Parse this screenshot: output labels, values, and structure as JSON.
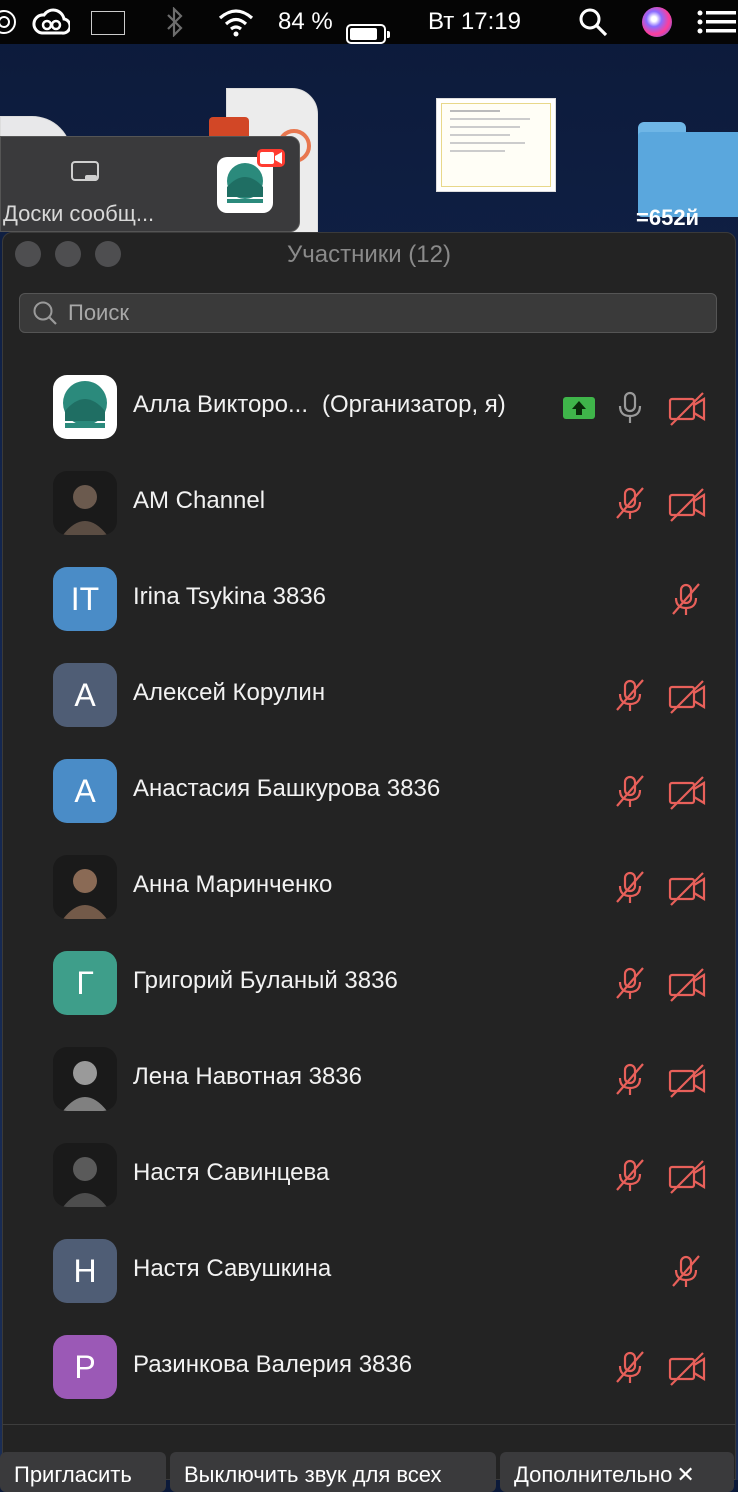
{
  "menubar": {
    "battery_percent": "84 %",
    "battery_level": 0.84,
    "datetime": "Вт 17:19",
    "icons": [
      "app-icon",
      "creative-cloud-icon",
      "flag-ru-icon",
      "bluetooth-icon",
      "wifi-icon",
      "battery-icon",
      "search-icon",
      "siri-icon",
      "menu-list-icon"
    ]
  },
  "desktop": {
    "folder_label": "=652й"
  },
  "mini_window": {
    "label": "Доски сообщ..."
  },
  "panel": {
    "title": "Участники (12)",
    "search_placeholder": "Поиск"
  },
  "participants": [
    {
      "name": "Алла Викторо...",
      "role": "(Организатор, я)",
      "avatar": {
        "type": "logo"
      },
      "sharing": true,
      "mic": "on",
      "cam": "off"
    },
    {
      "name": "AM Channel",
      "role": "",
      "avatar": {
        "type": "photo",
        "color": "#6b5a4e"
      },
      "sharing": false,
      "mic": "muted",
      "cam": "off"
    },
    {
      "name": "Irina Tsykina 3836",
      "role": "",
      "avatar": {
        "type": "initials",
        "text": "IT",
        "color": "#4a8cc7"
      },
      "sharing": false,
      "mic": "muted",
      "cam": "none"
    },
    {
      "name": "Алексей Корулин",
      "role": "",
      "avatar": {
        "type": "initials",
        "text": "А",
        "color": "#4f5d75"
      },
      "sharing": false,
      "mic": "muted",
      "cam": "off"
    },
    {
      "name": "Анастасия Башкурова 3836",
      "role": "",
      "avatar": {
        "type": "initials",
        "text": "А",
        "color": "#4a8cc7"
      },
      "sharing": false,
      "mic": "muted",
      "cam": "off"
    },
    {
      "name": "Анна Маринченко",
      "role": "",
      "avatar": {
        "type": "photo",
        "color": "#8a6a55"
      },
      "sharing": false,
      "mic": "muted",
      "cam": "off"
    },
    {
      "name": "Григорий Буланый 3836",
      "role": "",
      "avatar": {
        "type": "initials",
        "text": "Г",
        "color": "#3e9e8a"
      },
      "sharing": false,
      "mic": "muted",
      "cam": "off"
    },
    {
      "name": "Лена Навотная 3836",
      "role": "",
      "avatar": {
        "type": "photo",
        "color": "#9a9a9a"
      },
      "sharing": false,
      "mic": "muted",
      "cam": "off"
    },
    {
      "name": "Настя Савинцева",
      "role": "",
      "avatar": {
        "type": "photo",
        "color": "#5a5a5a"
      },
      "sharing": false,
      "mic": "muted",
      "cam": "off"
    },
    {
      "name": "Настя Савушкина",
      "role": "",
      "avatar": {
        "type": "initials",
        "text": "Н",
        "color": "#4f5d75"
      },
      "sharing": false,
      "mic": "muted",
      "cam": "none"
    },
    {
      "name": "Разинкова Валерия 3836",
      "role": "",
      "avatar": {
        "type": "initials",
        "text": "Р",
        "color": "#9b59b6"
      },
      "sharing": false,
      "mic": "muted",
      "cam": "off"
    }
  ],
  "buttons": {
    "invite": "Пригласить",
    "mute_all": "Выключить звук для всех",
    "more": "Дополнительно"
  }
}
